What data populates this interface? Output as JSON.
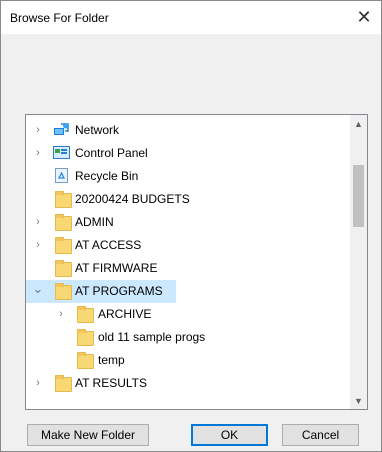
{
  "dialog": {
    "title": "Browse For Folder",
    "close_glyph": "✕"
  },
  "tree": {
    "items": [
      {
        "label": "Network",
        "icon": "network-icon",
        "expander": "›",
        "depth": 0
      },
      {
        "label": "Control Panel",
        "icon": "control-panel-icon",
        "expander": "›",
        "depth": 0
      },
      {
        "label": "Recycle Bin",
        "icon": "recycle-bin-icon",
        "expander": "",
        "depth": 0
      },
      {
        "label": "20200424 BUDGETS",
        "icon": "folder-icon",
        "expander": "",
        "depth": 0
      },
      {
        "label": "ADMIN",
        "icon": "folder-icon",
        "expander": "›",
        "depth": 0
      },
      {
        "label": "AT ACCESS",
        "icon": "folder-icon",
        "expander": "›",
        "depth": 0
      },
      {
        "label": "AT FIRMWARE",
        "icon": "folder-icon",
        "expander": "",
        "depth": 0
      },
      {
        "label": "AT PROGRAMS",
        "icon": "folder-icon",
        "expander": "⌄",
        "depth": 0,
        "selected": true
      },
      {
        "label": "ARCHIVE",
        "icon": "folder-icon",
        "expander": "›",
        "depth": 1
      },
      {
        "label": "old 11 sample progs",
        "icon": "folder-icon",
        "expander": "",
        "depth": 1
      },
      {
        "label": "temp",
        "icon": "folder-icon",
        "expander": "",
        "depth": 1
      },
      {
        "label": "AT RESULTS",
        "icon": "folder-icon",
        "expander": "›",
        "depth": 0
      }
    ]
  },
  "scrollbar": {
    "up_glyph": "▲",
    "down_glyph": "▼"
  },
  "buttons": {
    "make_new_folder": "Make New Folder",
    "ok": "OK",
    "cancel": "Cancel"
  }
}
